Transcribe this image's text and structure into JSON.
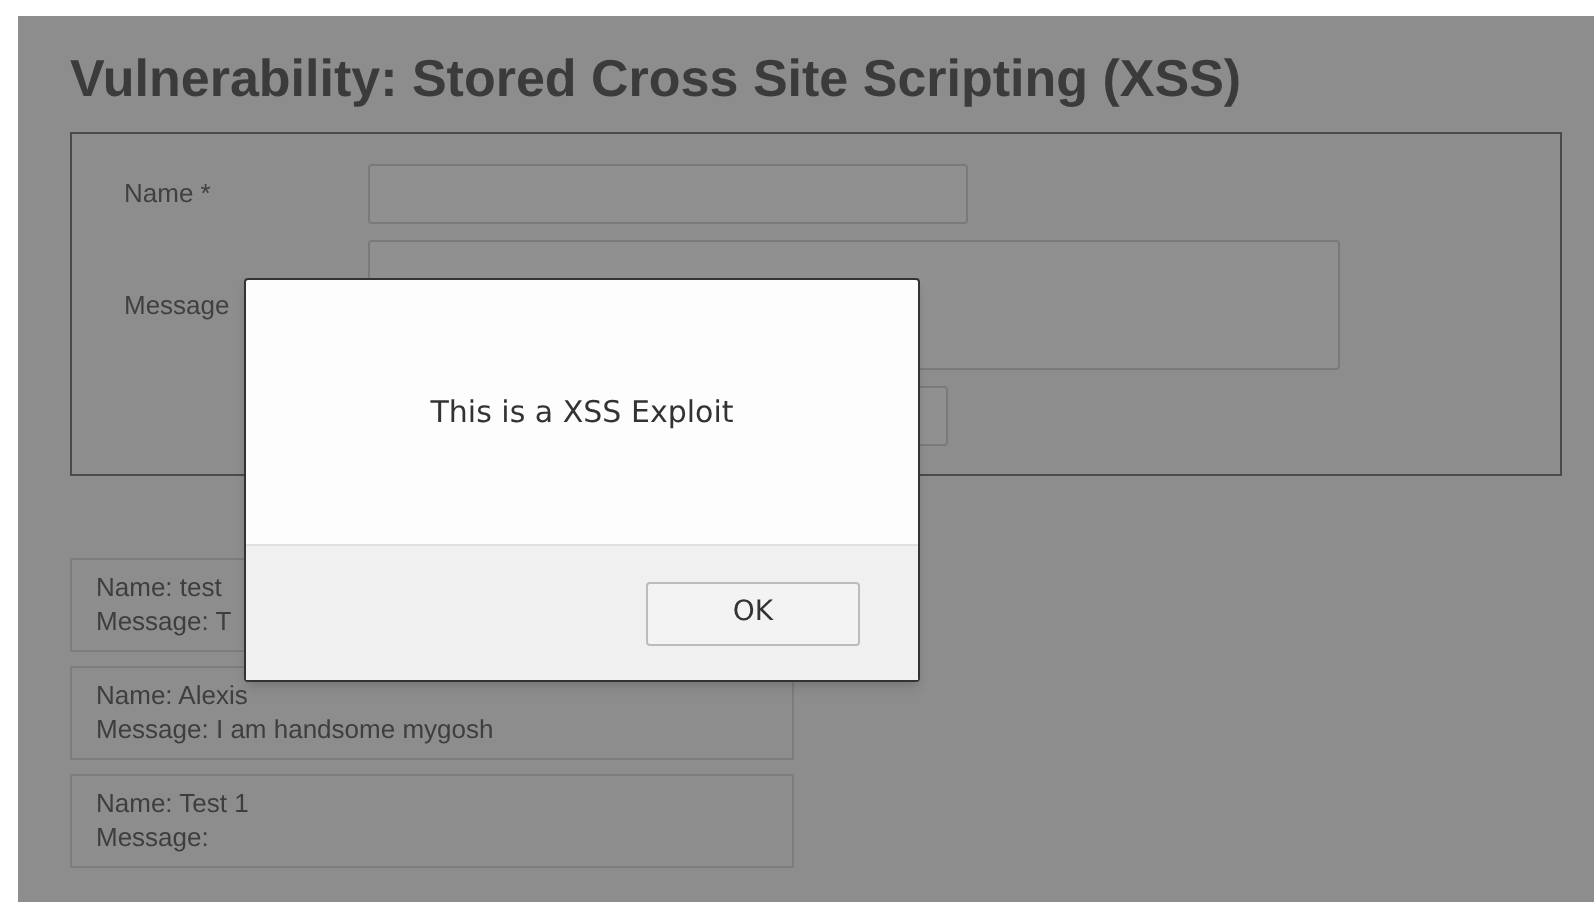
{
  "page": {
    "title": "Vulnerability: Stored Cross Site Scripting (XSS)"
  },
  "form": {
    "name_label": "Name *",
    "message_label": "Message"
  },
  "entries": [
    {
      "name": "Name: test",
      "message": "Message: T"
    },
    {
      "name": "Name: Alexis",
      "message": "Message: I am handsome mygosh"
    },
    {
      "name": "Name: Test 1",
      "message": "Message:"
    }
  ],
  "dialog": {
    "message": "This is a XSS Exploit",
    "button": "OK"
  }
}
